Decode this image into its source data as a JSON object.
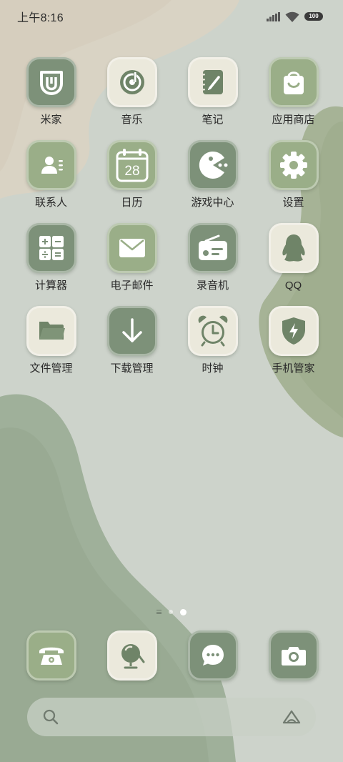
{
  "status_bar": {
    "time": "上午8:16",
    "battery": "100"
  },
  "apps": [
    {
      "label": "米家",
      "icon": "mijia-icon"
    },
    {
      "label": "音乐",
      "icon": "music-icon"
    },
    {
      "label": "笔记",
      "icon": "notes-icon"
    },
    {
      "label": "应用商店",
      "icon": "app-store-icon"
    },
    {
      "label": "联系人",
      "icon": "contacts-icon"
    },
    {
      "label": "日历",
      "icon": "calendar-icon",
      "date": "28"
    },
    {
      "label": "游戏中心",
      "icon": "game-center-icon"
    },
    {
      "label": "设置",
      "icon": "settings-icon"
    },
    {
      "label": "计算器",
      "icon": "calculator-icon"
    },
    {
      "label": "电子邮件",
      "icon": "email-icon"
    },
    {
      "label": "录音机",
      "icon": "recorder-icon"
    },
    {
      "label": "QQ",
      "icon": "qq-icon"
    },
    {
      "label": "文件管理",
      "icon": "folder-icon"
    },
    {
      "label": "下载管理",
      "icon": "download-icon"
    },
    {
      "label": "时钟",
      "icon": "clock-icon"
    },
    {
      "label": "手机管家",
      "icon": "security-icon"
    }
  ],
  "dock": [
    {
      "icon": "phone-icon"
    },
    {
      "icon": "browser-icon"
    },
    {
      "icon": "messages-icon"
    },
    {
      "icon": "camera-icon"
    }
  ],
  "page_indicator": {
    "pages": 2,
    "active": 2
  },
  "colors": {
    "tile_dark": "#7d9179",
    "tile_mid": "#9aae88",
    "tile_light": "#ebe9dc",
    "wallpaper_base": "#cdd3cb"
  }
}
